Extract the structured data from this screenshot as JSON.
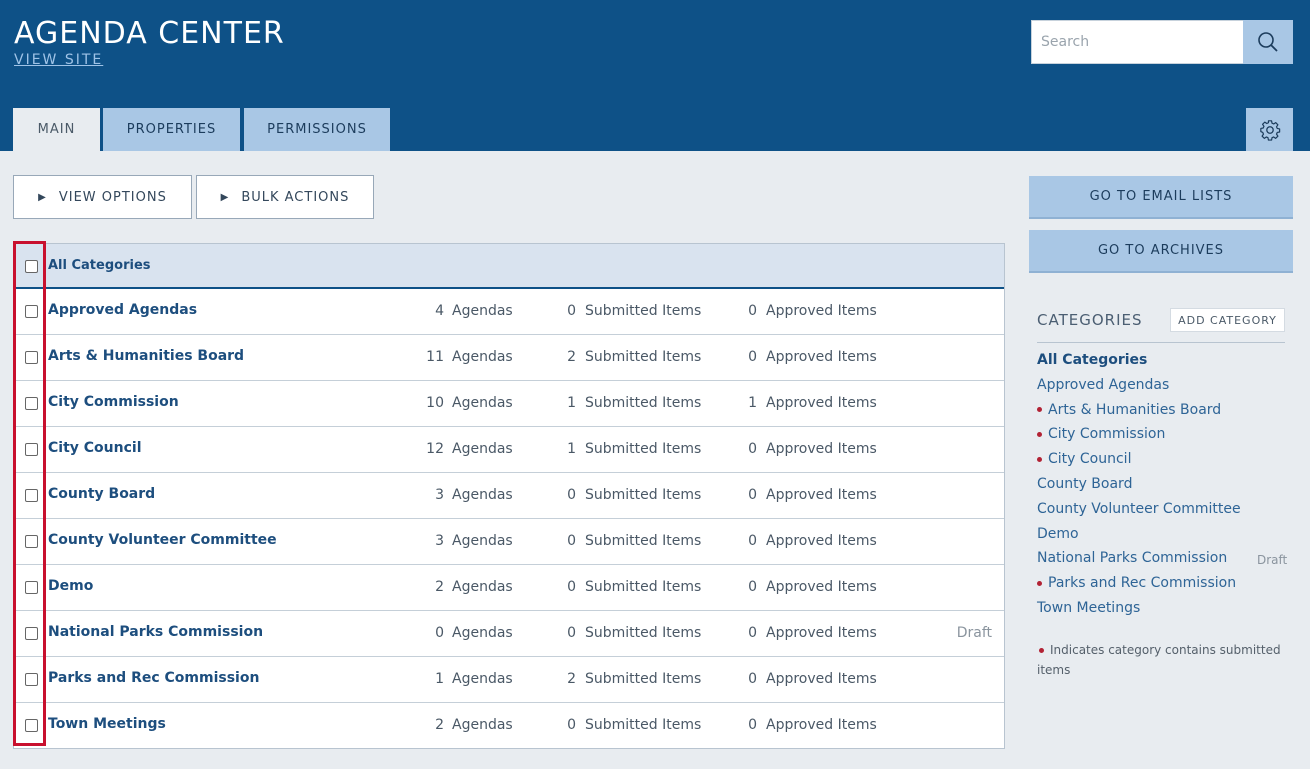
{
  "header": {
    "title": "AGENDA CENTER",
    "view_site": "VIEW SITE",
    "search_placeholder": "Search",
    "tabs": [
      "MAIN",
      "PROPERTIES",
      "PERMISSIONS"
    ]
  },
  "toolbar": {
    "view_options": "VIEW OPTIONS",
    "bulk_actions": "BULK ACTIONS"
  },
  "table": {
    "header_label": "All Categories",
    "rows": [
      {
        "name": "Approved Agendas",
        "agendas": "4",
        "submitted": "0",
        "approved": "0",
        "status": ""
      },
      {
        "name": "Arts & Humanities Board",
        "agendas": "11",
        "submitted": "2",
        "approved": "0",
        "status": ""
      },
      {
        "name": "City Commission",
        "agendas": "10",
        "submitted": "1",
        "approved": "1",
        "status": ""
      },
      {
        "name": "City Council",
        "agendas": "12",
        "submitted": "1",
        "approved": "0",
        "status": ""
      },
      {
        "name": "County Board",
        "agendas": "3",
        "submitted": "0",
        "approved": "0",
        "status": ""
      },
      {
        "name": "County Volunteer Committee",
        "agendas": "3",
        "submitted": "0",
        "approved": "0",
        "status": ""
      },
      {
        "name": "Demo",
        "agendas": "2",
        "submitted": "0",
        "approved": "0",
        "status": ""
      },
      {
        "name": "National Parks Commission",
        "agendas": "0",
        "submitted": "0",
        "approved": "0",
        "status": "Draft"
      },
      {
        "name": "Parks and Rec Commission",
        "agendas": "1",
        "submitted": "2",
        "approved": "0",
        "status": ""
      },
      {
        "name": "Town Meetings",
        "agendas": "2",
        "submitted": "0",
        "approved": "0",
        "status": ""
      }
    ],
    "agendas_label": "Agendas",
    "submitted_label": "Submitted Items",
    "approved_label": "Approved Items"
  },
  "sidebar": {
    "email_lists": "GO TO EMAIL LISTS",
    "archives": "GO TO ARCHIVES",
    "categories_title": "CATEGORIES",
    "add_category": "ADD CATEGORY",
    "items": [
      {
        "label": "All Categories",
        "dot": false,
        "bold": true
      },
      {
        "label": "Approved Agendas",
        "dot": false
      },
      {
        "label": "Arts & Humanities Board",
        "dot": true
      },
      {
        "label": "City Commission",
        "dot": true
      },
      {
        "label": "City Council",
        "dot": true
      },
      {
        "label": "County Board",
        "dot": false
      },
      {
        "label": "County Volunteer Committee",
        "dot": false
      },
      {
        "label": "Demo",
        "dot": false
      },
      {
        "label": "National Parks Commission",
        "dot": false
      },
      {
        "label": "Parks and Rec Commission",
        "dot": true
      },
      {
        "label": "Town Meetings",
        "dot": false
      }
    ],
    "draft_label": "Draft",
    "legend_text": "Indicates category contains submitted items"
  },
  "colors": {
    "header_bg": "#0e5187",
    "accent_light": "#a9c7e5",
    "link": "#1d4e7e",
    "dot": "#b22234",
    "highlight_box": "#c8102e"
  },
  "icons": [
    "search-icon",
    "gear-icon",
    "play-triangle-icon",
    "bullet-dot-icon"
  ]
}
